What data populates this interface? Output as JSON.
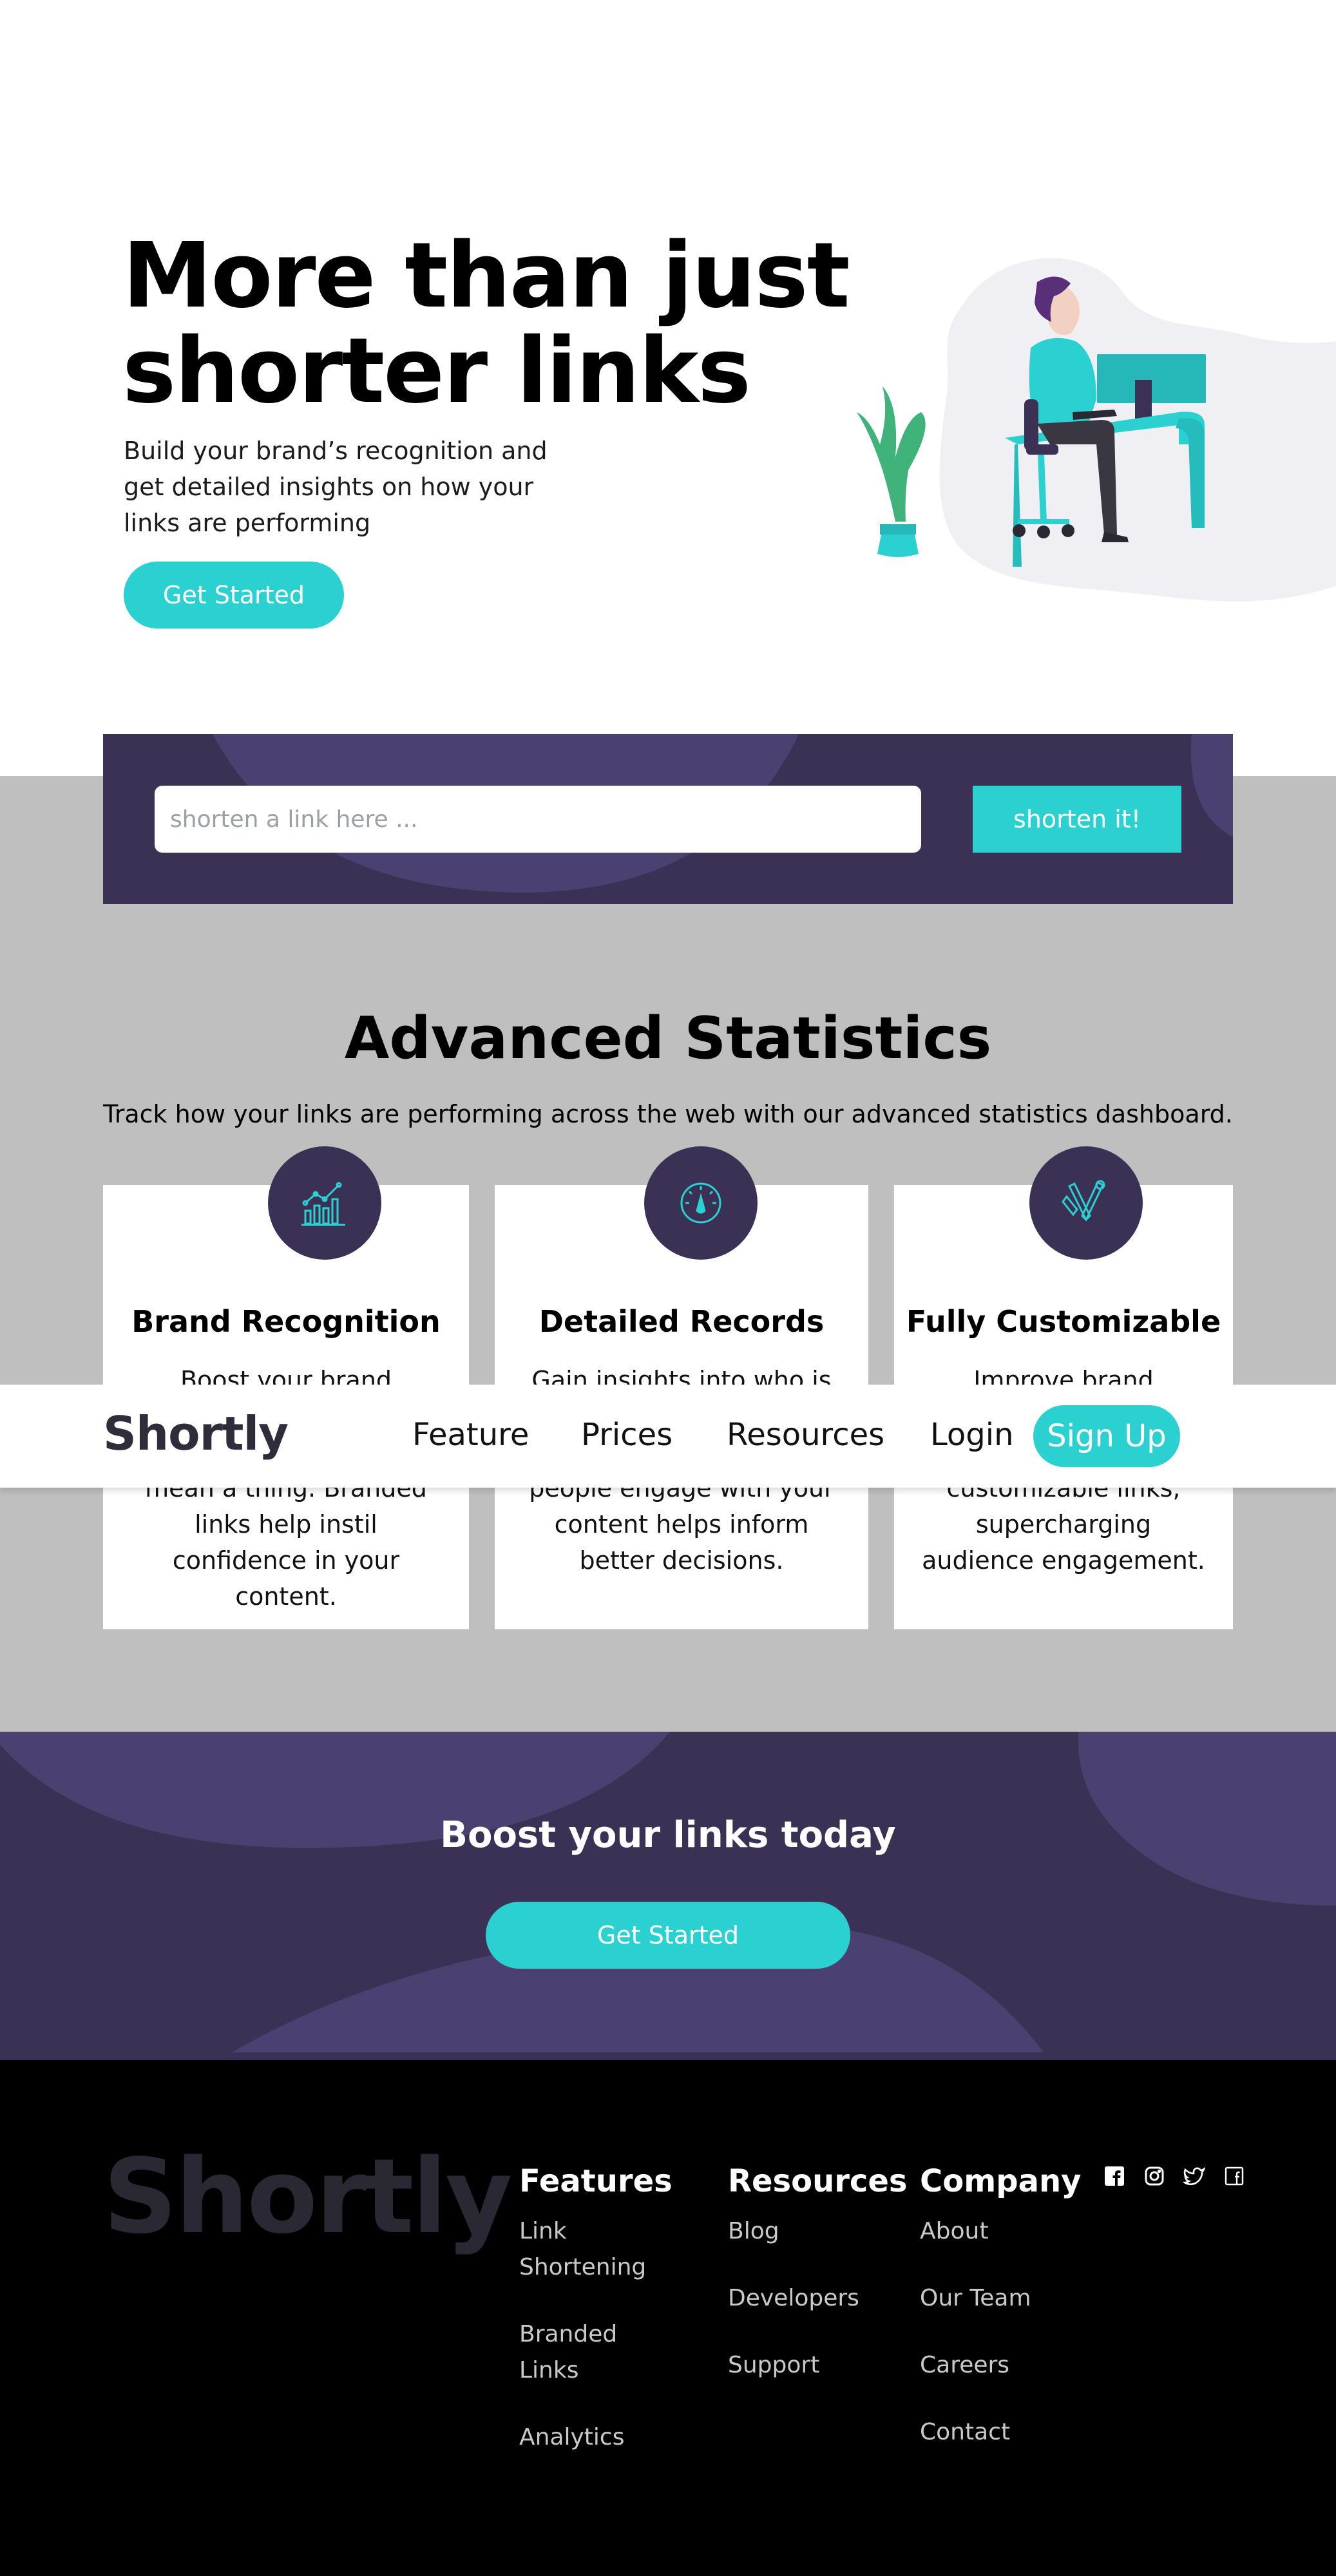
{
  "hero": {
    "title_line1": "More than just",
    "title_line2": "shorter links",
    "subtitle": "Build your brand’s recognition and get detailed insights on how your links are performing",
    "cta": "Get Started"
  },
  "shorten": {
    "placeholder": "shorten a link here ...",
    "button": "shorten it!"
  },
  "stats": {
    "title": "Advanced Statistics",
    "subtitle": "Track how your links are performing across the web with our advanced statistics dashboard.",
    "cards": [
      {
        "icon": "chart-icon",
        "title": "Brand Recognition",
        "text": "Boost your brand recognition with each click. Generic links don’t mean a thing. Branded links help instil confidence in your content."
      },
      {
        "icon": "gauge-icon",
        "title": "Detailed Records",
        "text": "Gain insights into who is clicking your links. Knowing when and where people engage with your content helps inform better decisions."
      },
      {
        "icon": "pen-tools-icon",
        "title": "Fully Customizable",
        "text": "Improve brand awareness and content discoverability through customizable links, supercharging audience engagement."
      }
    ]
  },
  "nav": {
    "logo": "Shortly",
    "items": [
      "Feature",
      "Prices",
      "Resources"
    ],
    "login": "Login",
    "signup": "Sign Up"
  },
  "boost": {
    "title": "Boost your links today",
    "cta": "Get Started"
  },
  "footer": {
    "logo": "Shortly",
    "columns": [
      {
        "heading": "Features",
        "links": [
          "Link Shortening",
          "Branded Links",
          "Analytics"
        ]
      },
      {
        "heading": "Resources",
        "links": [
          "Blog",
          "Developers",
          "Support"
        ]
      },
      {
        "heading": "Company",
        "links": [
          "About",
          "Our Team",
          "Careers",
          "Contact"
        ]
      }
    ],
    "socials": [
      "facebook-icon",
      "instagram-icon",
      "twitter-icon",
      "facebook-alt-icon"
    ]
  },
  "colors": {
    "accent": "#2bd0d0",
    "dark_violet": "#3b3154",
    "gray_bg": "#bfbfbf",
    "footer_bg": "#000000"
  }
}
